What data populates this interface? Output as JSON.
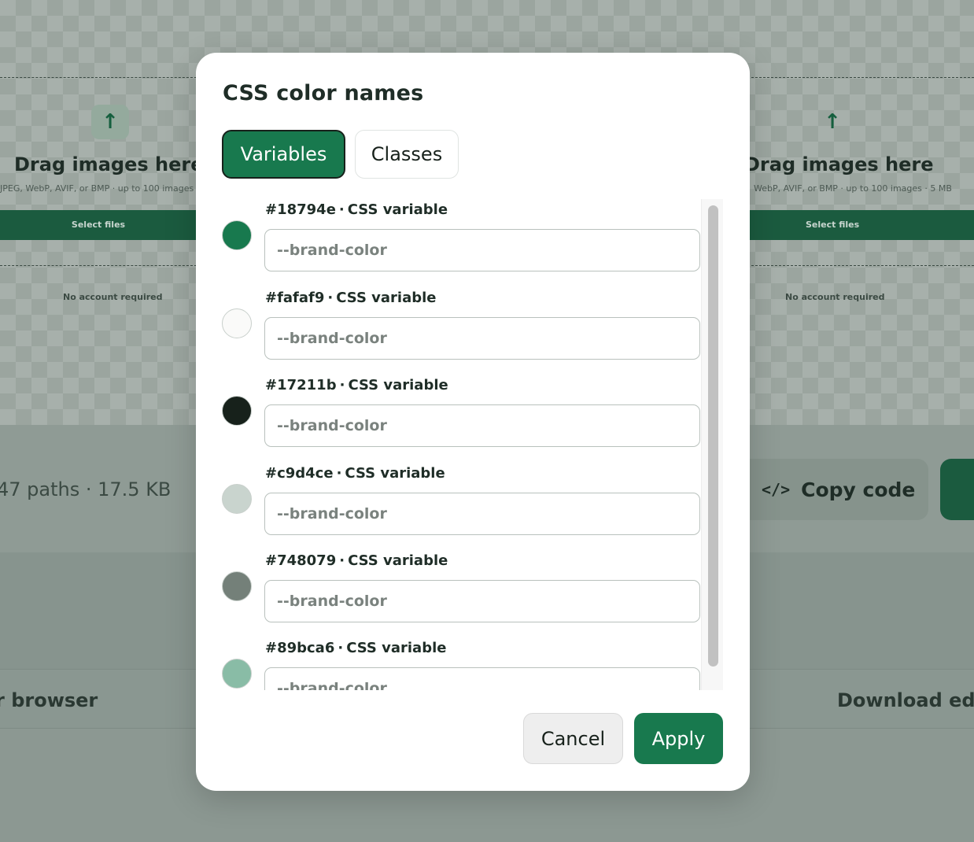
{
  "background": {
    "left_panel": {
      "upload_icon": "arrow-up-icon",
      "title": "Drag images here",
      "subtitle": "JPEG, WebP, AVIF, or BMP · up to 100 images",
      "select_button": "Select files",
      "note": "No account required"
    },
    "right_panel": {
      "upload_icon": "arrow-up-icon",
      "title": "Drag images here",
      "subtitle": "WebP, AVIF, or BMP · up to 100 images · 5 MB",
      "select_button": "Select files",
      "note": "No account required"
    },
    "stats": "47 paths · 17.5 KB",
    "copy_code": {
      "icon": "code-icon",
      "label": "Copy code"
    },
    "browser_text": "r browser",
    "download_text": "Download edit"
  },
  "modal": {
    "title": "CSS color names",
    "tabs": [
      {
        "label": "Variables",
        "active": true
      },
      {
        "label": "Classes",
        "active": false
      }
    ],
    "rows": [
      {
        "hex": "#18794e",
        "swatch": "#18794e",
        "kind": "CSS variable",
        "placeholder": "--brand-color"
      },
      {
        "hex": "#fafaf9",
        "swatch": "#fafaf9",
        "kind": "CSS variable",
        "placeholder": "--brand-color"
      },
      {
        "hex": "#17211b",
        "swatch": "#17211b",
        "kind": "CSS variable",
        "placeholder": "--brand-color"
      },
      {
        "hex": "#c9d4ce",
        "swatch": "#c9d4ce",
        "kind": "CSS variable",
        "placeholder": "--brand-color"
      },
      {
        "hex": "#748079",
        "swatch": "#748079",
        "kind": "CSS variable",
        "placeholder": "--brand-color"
      },
      {
        "hex": "#89bca6",
        "swatch": "#89bca6",
        "kind": "CSS variable",
        "placeholder": "--brand-color"
      }
    ],
    "cancel_label": "Cancel",
    "apply_label": "Apply"
  },
  "colors": {
    "accent": "#18794e",
    "dark": "#17211b"
  }
}
